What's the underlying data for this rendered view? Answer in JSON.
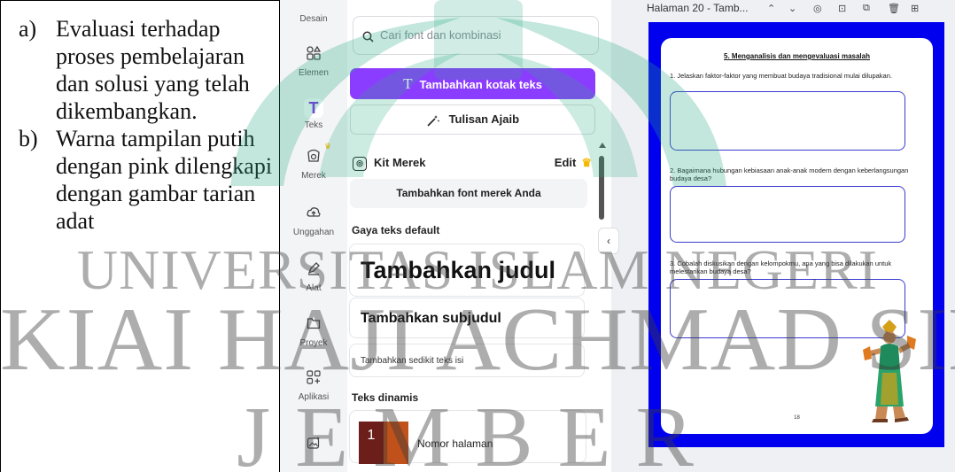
{
  "document": {
    "items": [
      {
        "marker": "a)",
        "text": "Evaluasi terhadap proses pembelajaran dan solusi yang telah dikembangkan."
      },
      {
        "marker": "b)",
        "text": "Warna tampilan putih dengan pink dilengkapi dengan gambar tarian adat"
      }
    ]
  },
  "canva": {
    "rail": [
      {
        "label": "Desain",
        "icon": "design-icon"
      },
      {
        "label": "Elemen",
        "icon": "elements-icon"
      },
      {
        "label": "Teks",
        "icon": "text-icon",
        "glyph": "T"
      },
      {
        "label": "Merek",
        "icon": "brand-icon"
      },
      {
        "label": "Unggahan",
        "icon": "upload-icon"
      },
      {
        "label": "Alat",
        "icon": "draw-icon"
      },
      {
        "label": "Proyek",
        "icon": "folder-icon"
      },
      {
        "label": "Aplikasi",
        "icon": "apps-icon"
      }
    ],
    "panel": {
      "search_placeholder": "Cari font dan kombinasi",
      "add_textbox": "Tambahkan kotak teks",
      "magic_write": "Tulisan Ajaib",
      "brand_kit": "Kit Merek",
      "edit": "Edit",
      "add_brand_font": "Tambahkan font merek Anda",
      "default_styles": "Gaya teks default",
      "heading": "Tambahkan judul",
      "subheading": "Tambahkan subjudul",
      "body": "Tambahkan sedikit teks isi",
      "dynamic_text": "Teks dinamis",
      "page_number": "Nomor halaman",
      "page_number_glyph": "1"
    },
    "pagebar": {
      "title": "Halaman 20 - Tamb..."
    },
    "worksheet": {
      "title": "5. Menganalisis dan mengevaluasi masalah",
      "questions": [
        "1. Jelaskan faktor-faktor yang membuat budaya tradisional mulai dilupakan.",
        "2. Bagaimana hubungan kebiasaan anak-anak modern dengan keberlangsungan budaya desa?",
        "3. Cobalah diskusikan dengan kelompokmu, apa yang bisa dilakukan untuk melestarikan budaya desa?"
      ],
      "page_number": "18"
    }
  },
  "watermark": {
    "line1": "UNIVERSITAS ISLAM NEGERI",
    "line2": "KIAI HAJI ACHMAD SIDDIQ",
    "line3": "JEMBER"
  },
  "colors": {
    "primary": "#8b3dff",
    "sheet_border": "#0000ee",
    "answer_box": "#3b3bd1",
    "crown": "#f5b800"
  }
}
